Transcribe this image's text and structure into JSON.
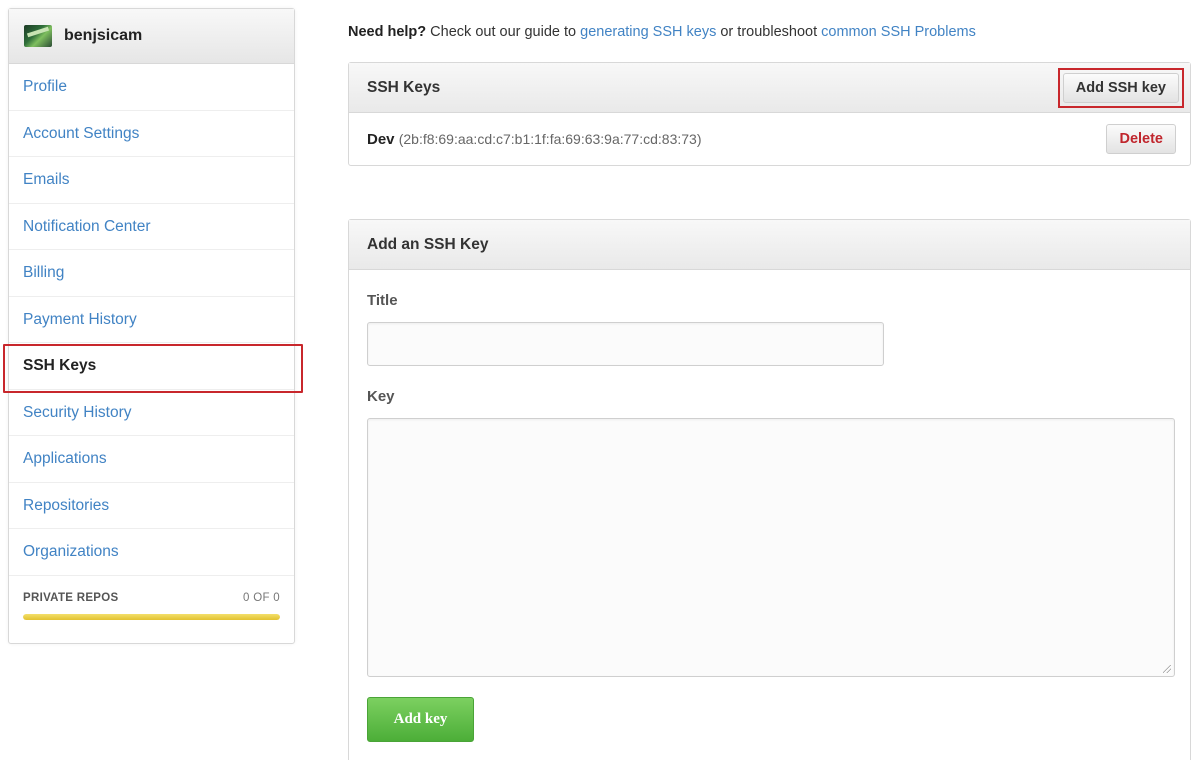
{
  "sidebar": {
    "username": "benjsicam",
    "avatar_icon": "user-avatar",
    "items": [
      {
        "label": "Profile",
        "selected": false
      },
      {
        "label": "Account Settings",
        "selected": false
      },
      {
        "label": "Emails",
        "selected": false
      },
      {
        "label": "Notification Center",
        "selected": false
      },
      {
        "label": "Billing",
        "selected": false
      },
      {
        "label": "Payment History",
        "selected": false
      },
      {
        "label": "SSH Keys",
        "selected": true
      },
      {
        "label": "Security History",
        "selected": false
      },
      {
        "label": "Applications",
        "selected": false
      },
      {
        "label": "Repositories",
        "selected": false
      },
      {
        "label": "Organizations",
        "selected": false
      }
    ],
    "private_repos": {
      "label": "PRIVATE REPOS",
      "count": "0 OF 0",
      "usage_fraction": 1.0,
      "bar_color": "#e2c230"
    }
  },
  "help": {
    "lead": "Need help?",
    "text1": " Check out our guide to ",
    "link1": "generating SSH keys",
    "text2": " or troubleshoot ",
    "link2": "common SSH Problems"
  },
  "ssh_keys": {
    "title": "SSH Keys",
    "add_button": "Add SSH key",
    "keys": [
      {
        "name": "Dev",
        "fingerprint": "(2b:f8:69:aa:cd:c7:b1:1f:fa:69:63:9a:77:cd:83:73)",
        "delete_label": "Delete"
      }
    ]
  },
  "add_key_form": {
    "title": "Add an SSH Key",
    "title_label": "Title",
    "title_value": "",
    "key_label": "Key",
    "key_value": "",
    "submit_label": "Add key"
  },
  "colors": {
    "link": "#4183c4",
    "highlight": "#c8272c",
    "danger": "#c0262d",
    "primary_green": "#4cae38"
  }
}
